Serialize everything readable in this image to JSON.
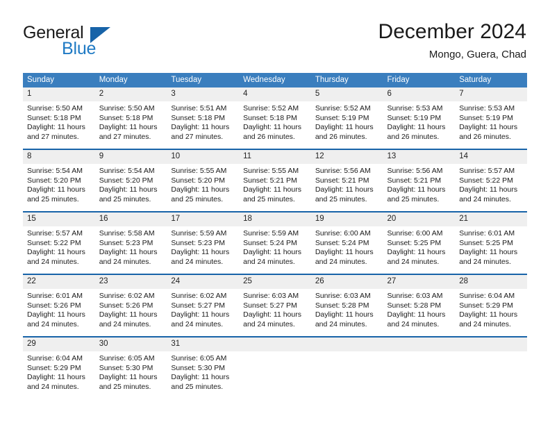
{
  "brand": {
    "word_one": "General",
    "word_two": "Blue",
    "accent_dark": "#1763a8",
    "accent_light": "#1f7ac4"
  },
  "header": {
    "title": "December 2024",
    "subtitle": "Mongo, Guera, Chad"
  },
  "calendar": {
    "header_bg": "#3a7ebe",
    "row_divider": "#1763a8",
    "daynum_bg": "#efefef",
    "weekdays": [
      "Sunday",
      "Monday",
      "Tuesday",
      "Wednesday",
      "Thursday",
      "Friday",
      "Saturday"
    ],
    "weeks": [
      [
        {
          "day": "1",
          "sunrise": "Sunrise: 5:50 AM",
          "sunset": "Sunset: 5:18 PM",
          "daylight_line1": "Daylight: 11 hours",
          "daylight_line2": "and 27 minutes."
        },
        {
          "day": "2",
          "sunrise": "Sunrise: 5:50 AM",
          "sunset": "Sunset: 5:18 PM",
          "daylight_line1": "Daylight: 11 hours",
          "daylight_line2": "and 27 minutes."
        },
        {
          "day": "3",
          "sunrise": "Sunrise: 5:51 AM",
          "sunset": "Sunset: 5:18 PM",
          "daylight_line1": "Daylight: 11 hours",
          "daylight_line2": "and 27 minutes."
        },
        {
          "day": "4",
          "sunrise": "Sunrise: 5:52 AM",
          "sunset": "Sunset: 5:18 PM",
          "daylight_line1": "Daylight: 11 hours",
          "daylight_line2": "and 26 minutes."
        },
        {
          "day": "5",
          "sunrise": "Sunrise: 5:52 AM",
          "sunset": "Sunset: 5:19 PM",
          "daylight_line1": "Daylight: 11 hours",
          "daylight_line2": "and 26 minutes."
        },
        {
          "day": "6",
          "sunrise": "Sunrise: 5:53 AM",
          "sunset": "Sunset: 5:19 PM",
          "daylight_line1": "Daylight: 11 hours",
          "daylight_line2": "and 26 minutes."
        },
        {
          "day": "7",
          "sunrise": "Sunrise: 5:53 AM",
          "sunset": "Sunset: 5:19 PM",
          "daylight_line1": "Daylight: 11 hours",
          "daylight_line2": "and 26 minutes."
        }
      ],
      [
        {
          "day": "8",
          "sunrise": "Sunrise: 5:54 AM",
          "sunset": "Sunset: 5:20 PM",
          "daylight_line1": "Daylight: 11 hours",
          "daylight_line2": "and 25 minutes."
        },
        {
          "day": "9",
          "sunrise": "Sunrise: 5:54 AM",
          "sunset": "Sunset: 5:20 PM",
          "daylight_line1": "Daylight: 11 hours",
          "daylight_line2": "and 25 minutes."
        },
        {
          "day": "10",
          "sunrise": "Sunrise: 5:55 AM",
          "sunset": "Sunset: 5:20 PM",
          "daylight_line1": "Daylight: 11 hours",
          "daylight_line2": "and 25 minutes."
        },
        {
          "day": "11",
          "sunrise": "Sunrise: 5:55 AM",
          "sunset": "Sunset: 5:21 PM",
          "daylight_line1": "Daylight: 11 hours",
          "daylight_line2": "and 25 minutes."
        },
        {
          "day": "12",
          "sunrise": "Sunrise: 5:56 AM",
          "sunset": "Sunset: 5:21 PM",
          "daylight_line1": "Daylight: 11 hours",
          "daylight_line2": "and 25 minutes."
        },
        {
          "day": "13",
          "sunrise": "Sunrise: 5:56 AM",
          "sunset": "Sunset: 5:21 PM",
          "daylight_line1": "Daylight: 11 hours",
          "daylight_line2": "and 25 minutes."
        },
        {
          "day": "14",
          "sunrise": "Sunrise: 5:57 AM",
          "sunset": "Sunset: 5:22 PM",
          "daylight_line1": "Daylight: 11 hours",
          "daylight_line2": "and 24 minutes."
        }
      ],
      [
        {
          "day": "15",
          "sunrise": "Sunrise: 5:57 AM",
          "sunset": "Sunset: 5:22 PM",
          "daylight_line1": "Daylight: 11 hours",
          "daylight_line2": "and 24 minutes."
        },
        {
          "day": "16",
          "sunrise": "Sunrise: 5:58 AM",
          "sunset": "Sunset: 5:23 PM",
          "daylight_line1": "Daylight: 11 hours",
          "daylight_line2": "and 24 minutes."
        },
        {
          "day": "17",
          "sunrise": "Sunrise: 5:59 AM",
          "sunset": "Sunset: 5:23 PM",
          "daylight_line1": "Daylight: 11 hours",
          "daylight_line2": "and 24 minutes."
        },
        {
          "day": "18",
          "sunrise": "Sunrise: 5:59 AM",
          "sunset": "Sunset: 5:24 PM",
          "daylight_line1": "Daylight: 11 hours",
          "daylight_line2": "and 24 minutes."
        },
        {
          "day": "19",
          "sunrise": "Sunrise: 6:00 AM",
          "sunset": "Sunset: 5:24 PM",
          "daylight_line1": "Daylight: 11 hours",
          "daylight_line2": "and 24 minutes."
        },
        {
          "day": "20",
          "sunrise": "Sunrise: 6:00 AM",
          "sunset": "Sunset: 5:25 PM",
          "daylight_line1": "Daylight: 11 hours",
          "daylight_line2": "and 24 minutes."
        },
        {
          "day": "21",
          "sunrise": "Sunrise: 6:01 AM",
          "sunset": "Sunset: 5:25 PM",
          "daylight_line1": "Daylight: 11 hours",
          "daylight_line2": "and 24 minutes."
        }
      ],
      [
        {
          "day": "22",
          "sunrise": "Sunrise: 6:01 AM",
          "sunset": "Sunset: 5:26 PM",
          "daylight_line1": "Daylight: 11 hours",
          "daylight_line2": "and 24 minutes."
        },
        {
          "day": "23",
          "sunrise": "Sunrise: 6:02 AM",
          "sunset": "Sunset: 5:26 PM",
          "daylight_line1": "Daylight: 11 hours",
          "daylight_line2": "and 24 minutes."
        },
        {
          "day": "24",
          "sunrise": "Sunrise: 6:02 AM",
          "sunset": "Sunset: 5:27 PM",
          "daylight_line1": "Daylight: 11 hours",
          "daylight_line2": "and 24 minutes."
        },
        {
          "day": "25",
          "sunrise": "Sunrise: 6:03 AM",
          "sunset": "Sunset: 5:27 PM",
          "daylight_line1": "Daylight: 11 hours",
          "daylight_line2": "and 24 minutes."
        },
        {
          "day": "26",
          "sunrise": "Sunrise: 6:03 AM",
          "sunset": "Sunset: 5:28 PM",
          "daylight_line1": "Daylight: 11 hours",
          "daylight_line2": "and 24 minutes."
        },
        {
          "day": "27",
          "sunrise": "Sunrise: 6:03 AM",
          "sunset": "Sunset: 5:28 PM",
          "daylight_line1": "Daylight: 11 hours",
          "daylight_line2": "and 24 minutes."
        },
        {
          "day": "28",
          "sunrise": "Sunrise: 6:04 AM",
          "sunset": "Sunset: 5:29 PM",
          "daylight_line1": "Daylight: 11 hours",
          "daylight_line2": "and 24 minutes."
        }
      ],
      [
        {
          "day": "29",
          "sunrise": "Sunrise: 6:04 AM",
          "sunset": "Sunset: 5:29 PM",
          "daylight_line1": "Daylight: 11 hours",
          "daylight_line2": "and 24 minutes."
        },
        {
          "day": "30",
          "sunrise": "Sunrise: 6:05 AM",
          "sunset": "Sunset: 5:30 PM",
          "daylight_line1": "Daylight: 11 hours",
          "daylight_line2": "and 25 minutes."
        },
        {
          "day": "31",
          "sunrise": "Sunrise: 6:05 AM",
          "sunset": "Sunset: 5:30 PM",
          "daylight_line1": "Daylight: 11 hours",
          "daylight_line2": "and 25 minutes."
        },
        {
          "day": "",
          "sunrise": "",
          "sunset": "",
          "daylight_line1": "",
          "daylight_line2": ""
        },
        {
          "day": "",
          "sunrise": "",
          "sunset": "",
          "daylight_line1": "",
          "daylight_line2": ""
        },
        {
          "day": "",
          "sunrise": "",
          "sunset": "",
          "daylight_line1": "",
          "daylight_line2": ""
        },
        {
          "day": "",
          "sunrise": "",
          "sunset": "",
          "daylight_line1": "",
          "daylight_line2": ""
        }
      ]
    ]
  }
}
